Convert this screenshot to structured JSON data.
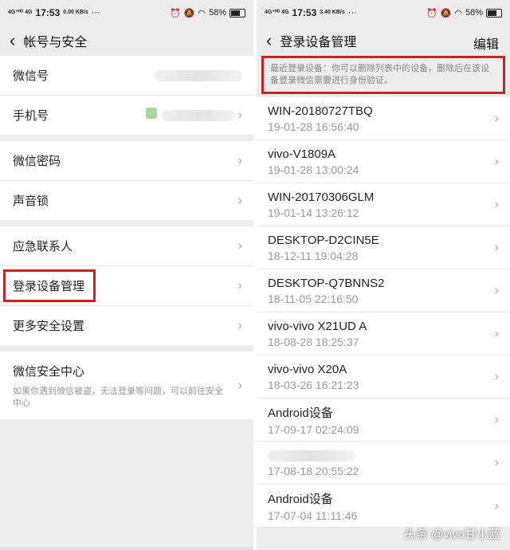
{
  "status": {
    "left": {
      "network": "4G⁺ᴴᴰ 4G",
      "time": "17:53",
      "speed": "0.00 KB/s",
      "dots": "···"
    },
    "right": {
      "network": "4G⁺ᴴᴰ 4G",
      "time": "17:53",
      "speed": "3.40 KB/s",
      "dots": "···"
    },
    "battery": "58%"
  },
  "left": {
    "nav_title": "帐号与安全",
    "groups": [
      [
        {
          "label": "微信号"
        },
        {
          "label": "手机号"
        }
      ],
      [
        {
          "label": "微信密码"
        },
        {
          "label": "声音锁"
        }
      ],
      [
        {
          "label": "应急联系人"
        },
        {
          "label": "登录设备管理"
        },
        {
          "label": "更多安全设置"
        }
      ]
    ],
    "security_center": {
      "title": "微信安全中心",
      "desc": "如果你遇到微信被盗，无法登录等问题，可以前往安全中心"
    }
  },
  "right": {
    "nav_title": "登录设备管理",
    "edit_label": "编辑",
    "hint": "最近登录设备：你可以删除列表中的设备，删除后在该设备登录微信需要进行身份验证。",
    "devices": [
      {
        "name": "WIN-20180727TBQ",
        "time": "19-01-28 16:56:40"
      },
      {
        "name": "vivo-V1809A",
        "time": "19-01-28 13:00:24"
      },
      {
        "name": "WIN-20170306GLM",
        "time": "19-01-14 13:26:12"
      },
      {
        "name": "DESKTOP-D2CIN5E",
        "time": "18-12-11 19:04:28"
      },
      {
        "name": "DESKTOP-Q7BNNS2",
        "time": "18-11-05 22:16:50"
      },
      {
        "name": "vivo-vivo X21UD A",
        "time": "18-08-28 18:25:37"
      },
      {
        "name": "vivo-vivo X20A",
        "time": "18-03-26 16:21:23"
      },
      {
        "name": "Android设备",
        "time": "17-09-17 02:24:09"
      },
      {
        "name": "",
        "time": "17-08-18 20:55:22"
      },
      {
        "name": "Android设备",
        "time": "17-07-04 11:11:46"
      }
    ]
  },
  "watermark": "头条 @vivo甘小蓝",
  "icons": {
    "back": "chevron-left-icon",
    "chevron": "chevron-right-icon"
  },
  "colors": {
    "highlight": "#d61d1d",
    "background": "#ededed"
  }
}
